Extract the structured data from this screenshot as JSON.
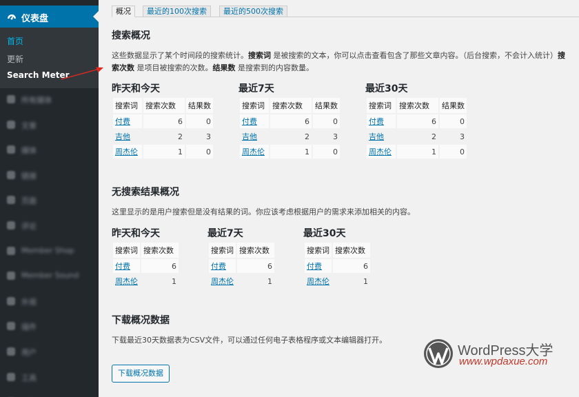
{
  "sidebar": {
    "dashboard_label": "仪表盘",
    "submenu": {
      "home": "首页",
      "updates": "更新",
      "search_meter": "Search Meter"
    },
    "blurred_items": [
      {
        "icon": "media-icon",
        "label": "所有媒体"
      },
      {
        "icon": "posts-icon",
        "label": "文章"
      },
      {
        "icon": "media-icon",
        "label": "媒体"
      },
      {
        "icon": "links-icon",
        "label": "链接"
      },
      {
        "icon": "pages-icon",
        "label": "页面"
      },
      {
        "icon": "comments-icon",
        "label": "评论"
      },
      {
        "icon": "plugin-icon",
        "label": "Member Shop"
      },
      {
        "icon": "plugin-icon",
        "label": "Member Sound"
      },
      {
        "icon": "appearance-icon",
        "label": "外观"
      },
      {
        "icon": "plugins-icon",
        "label": "插件"
      },
      {
        "icon": "users-icon",
        "label": "用户"
      },
      {
        "icon": "tools-icon",
        "label": "工具"
      },
      {
        "icon": "settings-icon",
        "label": "设置"
      }
    ]
  },
  "tabs": [
    "概况",
    "最近的100次搜索",
    "最近的500次搜索"
  ],
  "section1": {
    "title": "搜索概况",
    "desc_part1": "这些数据显示了某个时间段的搜索统计。",
    "desc_term_kw": "搜索词",
    "desc_part2": " 是被搜索的文本，你可以点击查看包含了那些文章内容。（后台搜索，不会计入统计）",
    "desc_count_kw": "搜索次数",
    "desc_part3": " 是项目被搜索的次数。",
    "desc_results_kw": "结果数",
    "desc_part4": " 是搜索到的内容数量。"
  },
  "stats_tables": [
    {
      "title": "昨天和今天",
      "headers": [
        "搜索词",
        "搜索次数",
        "结果数"
      ],
      "rows": [
        [
          "付费",
          "6",
          "0"
        ],
        [
          "吉他",
          "2",
          "3"
        ],
        [
          "周杰伦",
          "1",
          "0"
        ]
      ]
    },
    {
      "title": "最近7天",
      "headers": [
        "搜索词",
        "搜索次数",
        "结果数"
      ],
      "rows": [
        [
          "付费",
          "6",
          "0"
        ],
        [
          "吉他",
          "2",
          "3"
        ],
        [
          "周杰伦",
          "1",
          "0"
        ]
      ]
    },
    {
      "title": "最近30天",
      "headers": [
        "搜索词",
        "搜索次数",
        "结果数"
      ],
      "rows": [
        [
          "付费",
          "6",
          "0"
        ],
        [
          "吉他",
          "2",
          "3"
        ],
        [
          "周杰伦",
          "1",
          "0"
        ]
      ]
    }
  ],
  "section2": {
    "title": "无搜索结果概况",
    "desc": "这里显示的是用户搜索但是没有结果的词。你应该考虑根据用户的需求来添加相关的内容。"
  },
  "noresult_tables": [
    {
      "title": "昨天和今天",
      "headers": [
        "搜索词",
        "搜索次数"
      ],
      "rows": [
        [
          "付费",
          "6"
        ],
        [
          "周杰伦",
          "1"
        ]
      ]
    },
    {
      "title": "最近7天",
      "headers": [
        "搜索词",
        "搜索次数"
      ],
      "rows": [
        [
          "付费",
          "6"
        ],
        [
          "周杰伦",
          "1"
        ]
      ]
    },
    {
      "title": "最近30天",
      "headers": [
        "搜索词",
        "搜索次数"
      ],
      "rows": [
        [
          "付费",
          "6"
        ],
        [
          "周杰伦",
          "1"
        ]
      ]
    }
  ],
  "section3": {
    "title": "下载概况数据",
    "desc": "下载最近30天数据表为CSV文件，可以通过任何电子表格程序或文本编辑器打开。",
    "button": "下载概况数据"
  },
  "watermark": {
    "brand": "WordPress大学",
    "url": "www.wpdaxue.com"
  },
  "colors": {
    "sidebar_bg": "#23282d",
    "submenu_bg": "#32373c",
    "accent": "#0073aa",
    "current": "#00b9eb",
    "arrow": "#e0281e",
    "watermark_red": "#c0392b"
  }
}
